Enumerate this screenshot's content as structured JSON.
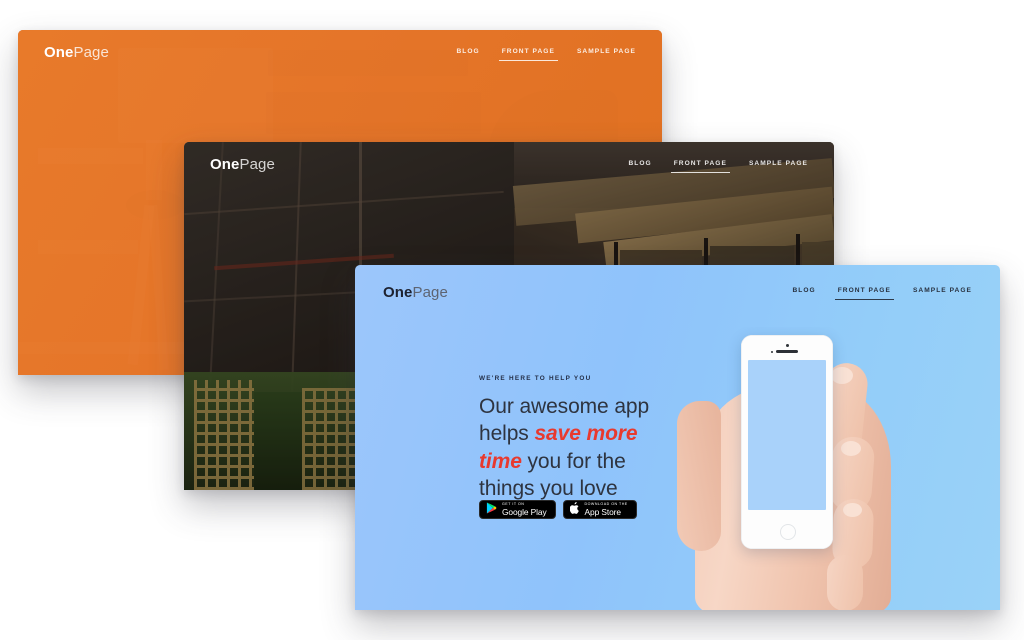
{
  "page": {
    "background_color": "#ffffff",
    "description": "Three overlapping website homepage screenshots of the OnePage theme"
  },
  "panels": [
    {
      "id": "orange",
      "theme": "orange-overlay",
      "background_color": "#e8762a",
      "logo": {
        "bold": "One",
        "light": "Page"
      },
      "nav": [
        {
          "label": "BLOG",
          "active": false
        },
        {
          "label": "FRONT PAGE",
          "active": true
        },
        {
          "label": "SAMPLE PAGE",
          "active": false
        }
      ]
    },
    {
      "id": "dark",
      "theme": "dark-photo",
      "background_color": "#2b2722",
      "logo": {
        "bold": "One",
        "light": "Page"
      },
      "nav": [
        {
          "label": "BLOG",
          "active": false
        },
        {
          "label": "FRONT PAGE",
          "active": true
        },
        {
          "label": "SAMPLE PAGE",
          "active": false
        }
      ]
    },
    {
      "id": "blue",
      "theme": "blue-gradient",
      "background_color": "#95c7fb",
      "logo": {
        "bold": "One",
        "light": "Page"
      },
      "nav": [
        {
          "label": "BLOG",
          "active": false
        },
        {
          "label": "FRONT PAGE",
          "active": true
        },
        {
          "label": "SAMPLE PAGE",
          "active": false
        }
      ],
      "hero": {
        "eyebrow": "WE'RE HERE TO HELP YOU",
        "headline_part1": "Our awesome app helps ",
        "headline_highlight": "save more time",
        "headline_part2": " you for the things you love",
        "highlight_color": "#e8392e",
        "text_color": "#2e3440"
      },
      "badges": [
        {
          "name": "google-play",
          "top_label": "GET IT ON",
          "main_label": "Google Play",
          "icon": "google-play-icon"
        },
        {
          "name": "app-store",
          "top_label": "Download on the",
          "main_label": "App Store",
          "icon": "apple-icon"
        }
      ],
      "media": {
        "name": "hand-holding-phone",
        "description": "Hand holding a white smartphone with blank blue screen"
      }
    }
  ]
}
